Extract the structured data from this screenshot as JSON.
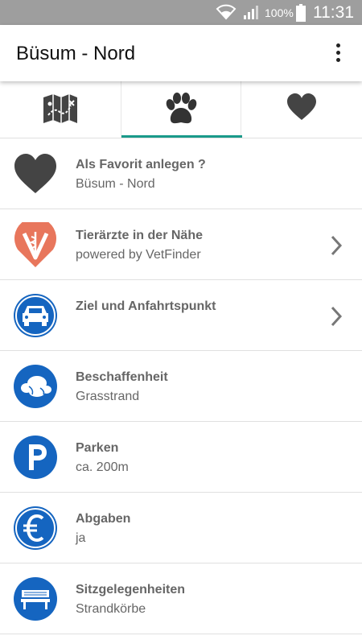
{
  "status_bar": {
    "battery_percent": "100%",
    "time": "11:31"
  },
  "app_bar": {
    "title": "Büsum - Nord",
    "menu_icon": "more-vert-icon"
  },
  "tabs": [
    {
      "icon": "map-icon",
      "selected": false
    },
    {
      "icon": "paw-icon",
      "selected": true
    },
    {
      "icon": "heart-icon",
      "selected": false
    }
  ],
  "colors": {
    "accent": "#1a9a8a",
    "blue": "#1565c0",
    "vet_orange": "#e8765c",
    "text": "#666666",
    "status_bar": "#9e9e9e"
  },
  "items": [
    {
      "icon": "heart-icon",
      "primary": "Als Favorit anlegen ?",
      "secondary": "Büsum - Nord",
      "chevron": false
    },
    {
      "icon": "vetfinder-icon",
      "primary": "Tierärzte in der Nähe",
      "secondary": "powered by VetFinder",
      "chevron": true
    },
    {
      "icon": "car-icon",
      "primary": "Ziel und Anfahrtspunkt",
      "secondary": "",
      "chevron": true
    },
    {
      "icon": "terrain-icon",
      "primary": "Beschaffenheit",
      "secondary": "Grasstrand",
      "chevron": false
    },
    {
      "icon": "parking-icon",
      "primary": "Parken",
      "secondary": "ca. 200m",
      "chevron": false
    },
    {
      "icon": "euro-icon",
      "primary": "Abgaben",
      "secondary": "ja",
      "chevron": false
    },
    {
      "icon": "bench-icon",
      "primary": "Sitzgelegenheiten",
      "secondary": "Strandkörbe",
      "chevron": false
    }
  ]
}
